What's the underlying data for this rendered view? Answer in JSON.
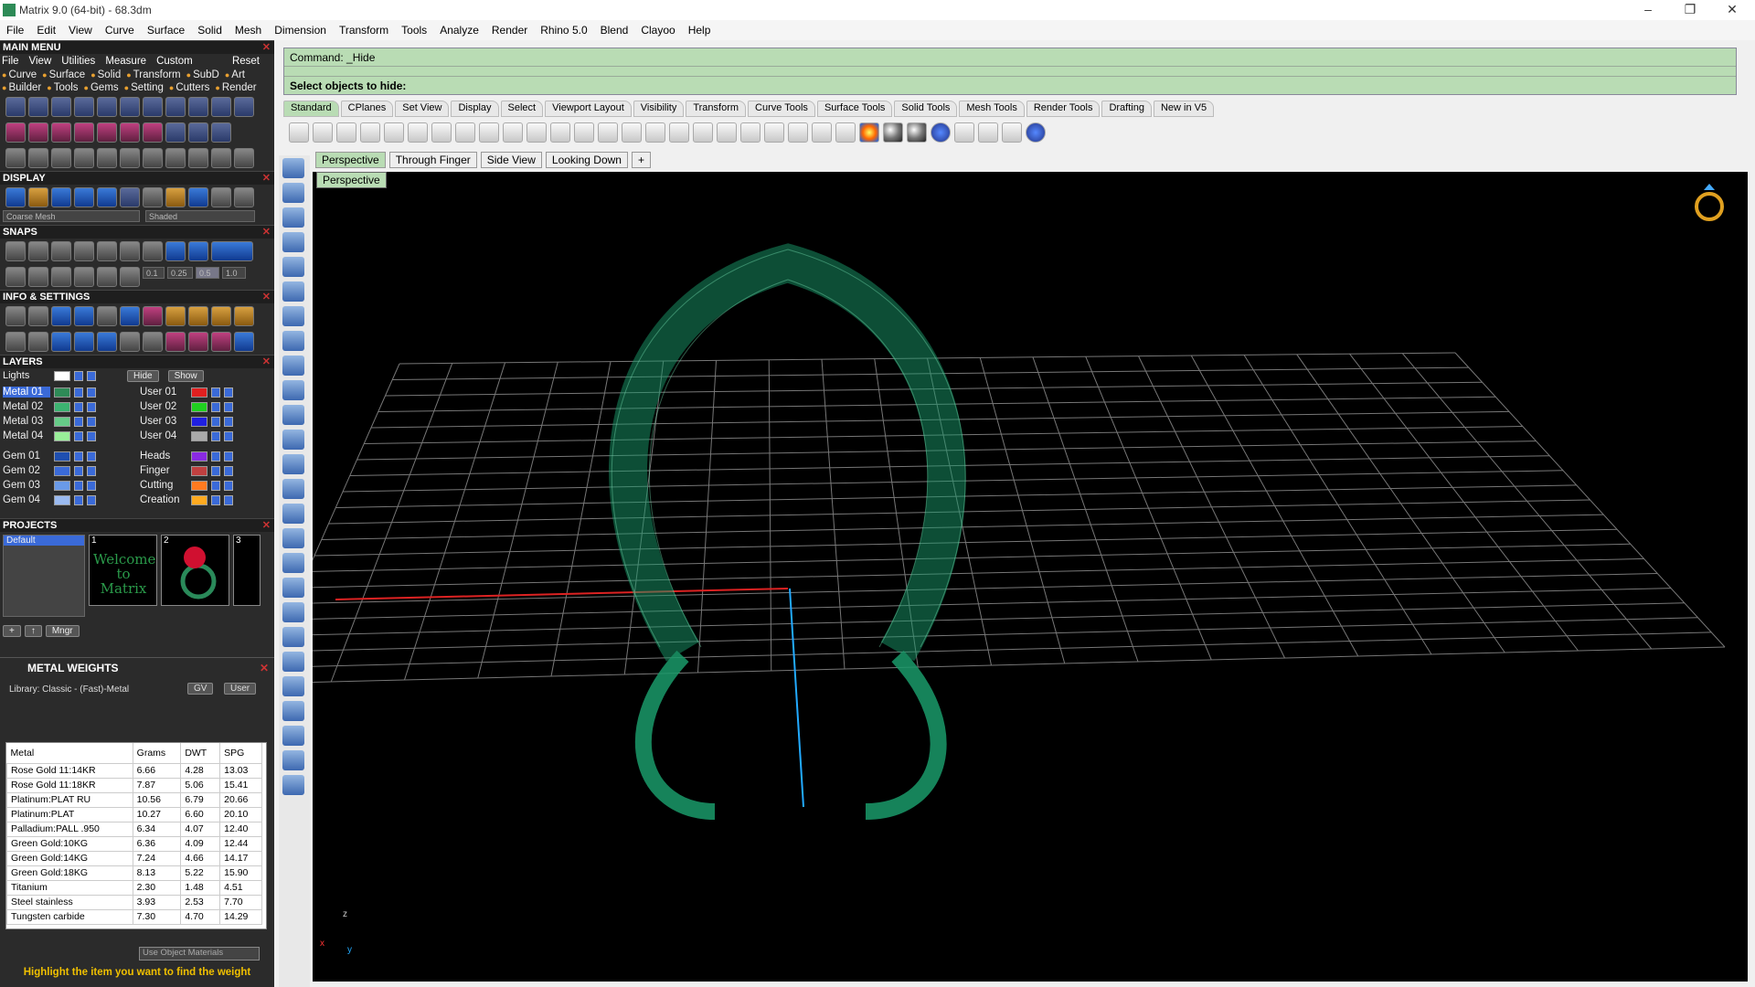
{
  "window": {
    "title": "Matrix 9.0 (64-bit) - 68.3dm"
  },
  "menubar": [
    "File",
    "Edit",
    "View",
    "Curve",
    "Surface",
    "Solid",
    "Mesh",
    "Dimension",
    "Transform",
    "Tools",
    "Analyze",
    "Render",
    "Rhino 5.0",
    "Blend",
    "Clayoo",
    "Help"
  ],
  "main_menu": {
    "title": "MAIN MENU",
    "submenu": [
      "File",
      "View",
      "Utilities",
      "Measure",
      "Custom"
    ],
    "reset": "Reset",
    "row1": [
      "Curve",
      "Surface",
      "Solid",
      "Transform",
      "SubD",
      "Art"
    ],
    "row2": [
      "Builder",
      "Tools",
      "Gems",
      "Setting",
      "Cutters",
      "Render"
    ]
  },
  "display": {
    "title": "DISPLAY",
    "mesh": "Coarse Mesh",
    "mode": "Shaded"
  },
  "snaps": {
    "title": "SNAPS",
    "values": [
      "0.1",
      "0.25",
      "0.5",
      "1.0"
    ]
  },
  "info": {
    "title": "INFO & SETTINGS"
  },
  "layers": {
    "title": "LAYERS",
    "lights": "Lights",
    "hide": "Hide",
    "show": "Show",
    "left": [
      {
        "name": "Metal 01",
        "color": "#2e8b57",
        "selected": true
      },
      {
        "name": "Metal 02",
        "color": "#3cb371"
      },
      {
        "name": "Metal 03",
        "color": "#66cc88"
      },
      {
        "name": "Metal 04",
        "color": "#99ee99"
      },
      {
        "name": "Gem 01",
        "color": "#1f4fb0"
      },
      {
        "name": "Gem 02",
        "color": "#3a6ad8"
      },
      {
        "name": "Gem 03",
        "color": "#6a9ae8"
      },
      {
        "name": "Gem 04",
        "color": "#9abaf0"
      }
    ],
    "right": [
      {
        "name": "User 01",
        "color": "#e02020"
      },
      {
        "name": "User 02",
        "color": "#20d020"
      },
      {
        "name": "User 03",
        "color": "#2020e0"
      },
      {
        "name": "User 04",
        "color": "#aaaaaa"
      },
      {
        "name": "Heads",
        "color": "#8a2ae2"
      },
      {
        "name": "Finger",
        "color": "#c04040"
      },
      {
        "name": "Cutting",
        "color": "#ff7a20"
      },
      {
        "name": "Creation",
        "color": "#ffaa20"
      }
    ]
  },
  "projects": {
    "title": "PROJECTS",
    "selected": "Default",
    "thumb1_num": "1",
    "thumb1_text": "Welcome to Matrix",
    "thumb2_num": "2",
    "thumb3_num": "3",
    "mngr": "Mngr"
  },
  "metal_weights": {
    "title": "METAL WEIGHTS",
    "library": "Library: Classic - (Fast)-Metal",
    "gv": "GV",
    "user": "User",
    "columns": [
      "Metal",
      "Grams",
      "DWT",
      "SPG"
    ],
    "rows": [
      [
        "Rose Gold 11:14KR",
        "6.66",
        "4.28",
        "13.03"
      ],
      [
        "Rose Gold 11:18KR",
        "7.87",
        "5.06",
        "15.41"
      ],
      [
        "Platinum:PLAT RU",
        "10.56",
        "6.79",
        "20.66"
      ],
      [
        "Platinum:PLAT",
        "10.27",
        "6.60",
        "20.10"
      ],
      [
        "Palladium:PALL .950",
        "6.34",
        "4.07",
        "12.40"
      ],
      [
        "Green Gold:10KG",
        "6.36",
        "4.09",
        "12.44"
      ],
      [
        "Green Gold:14KG",
        "7.24",
        "4.66",
        "14.17"
      ],
      [
        "Green Gold:18KG",
        "8.13",
        "5.22",
        "15.90"
      ],
      [
        "Titanium",
        "2.30",
        "1.48",
        "4.51"
      ],
      [
        "Steel stainless",
        "3.93",
        "2.53",
        "7.70"
      ],
      [
        "Tungsten carbide",
        "7.30",
        "4.70",
        "14.29"
      ]
    ],
    "use_object_materials": "Use Object Materials",
    "hint": "Highlight the item you want to find the weight"
  },
  "command": {
    "line1": "Command: _Hide",
    "prompt": "Select objects to hide:"
  },
  "toolbar_tabs": [
    "Standard",
    "CPlanes",
    "Set View",
    "Display",
    "Select",
    "Viewport Layout",
    "Visibility",
    "Transform",
    "Curve Tools",
    "Surface Tools",
    "Solid Tools",
    "Mesh Tools",
    "Render Tools",
    "Drafting",
    "New in V5"
  ],
  "viewport_tabs": [
    "Perspective",
    "Through Finger",
    "Side View",
    "Looking Down"
  ],
  "viewport": {
    "label": "Perspective",
    "axis_z": "z",
    "axis_x": "x",
    "axis_y": "y"
  }
}
